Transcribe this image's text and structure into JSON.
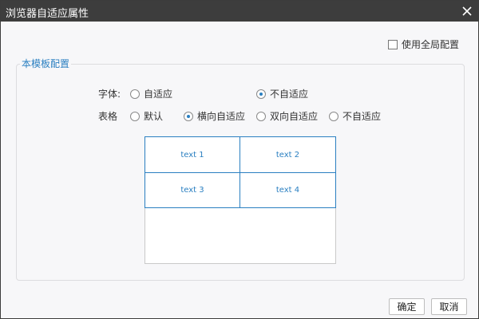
{
  "dialog": {
    "title": "浏览器自适应属性",
    "close_icon": "close-icon"
  },
  "global_config": {
    "label": "使用全局配置",
    "checked": false
  },
  "template_section": {
    "legend": "本模板配置",
    "font_row": {
      "label": "字体:",
      "options": [
        {
          "label": "自适应",
          "selected": false
        },
        {
          "label": "不自适应",
          "selected": true
        }
      ]
    },
    "table_row": {
      "label": "表格",
      "options": [
        {
          "label": "默认",
          "selected": false
        },
        {
          "label": "横向自适应",
          "selected": true
        },
        {
          "label": "双向自适应",
          "selected": false
        },
        {
          "label": "不自适应",
          "selected": false
        }
      ]
    },
    "preview": {
      "cells": [
        "text 1",
        "text 2",
        "text 3",
        "text 4"
      ]
    }
  },
  "buttons": {
    "ok": "确定",
    "cancel": "取消"
  },
  "colors": {
    "titlebar": "#3d3d3d",
    "accent": "#2a7fc1",
    "background": "#f7f7f9"
  }
}
